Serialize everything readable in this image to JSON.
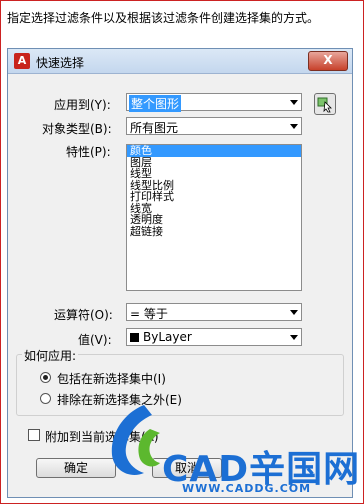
{
  "caption": "指定选择过滤条件以及根据该过滤条件创建选择集的方式。",
  "window": {
    "title": "快速选择",
    "close_glyph": "X",
    "app_icon_glyph": "A"
  },
  "apply_to": {
    "label": "应用到(Y):",
    "value": "整个图形"
  },
  "object_type": {
    "label": "对象类型(B):",
    "value": "所有图元"
  },
  "properties": {
    "label": "特性(P):",
    "items": [
      "颜色",
      "图层",
      "线型",
      "线型比例",
      "打印样式",
      "线宽",
      "透明度",
      "超链接"
    ],
    "selected_index": 0
  },
  "operator": {
    "label": "运算符(O):",
    "value": "= 等于"
  },
  "value": {
    "label": "值(V):",
    "value": "ByLayer",
    "swatch_color": "#000000"
  },
  "how_to_apply": {
    "title": "如何应用:",
    "include_label": "包括在新选择集中(I)",
    "exclude_label": "排除在新选择集之外(E)",
    "selected": "include"
  },
  "append": {
    "label": "附加到当前选择集(A)",
    "checked": false
  },
  "buttons": {
    "ok": "确定",
    "cancel": "取消"
  },
  "watermark": {
    "brand": "CAD辛国网",
    "url": "WWW.CADDG.COM"
  }
}
